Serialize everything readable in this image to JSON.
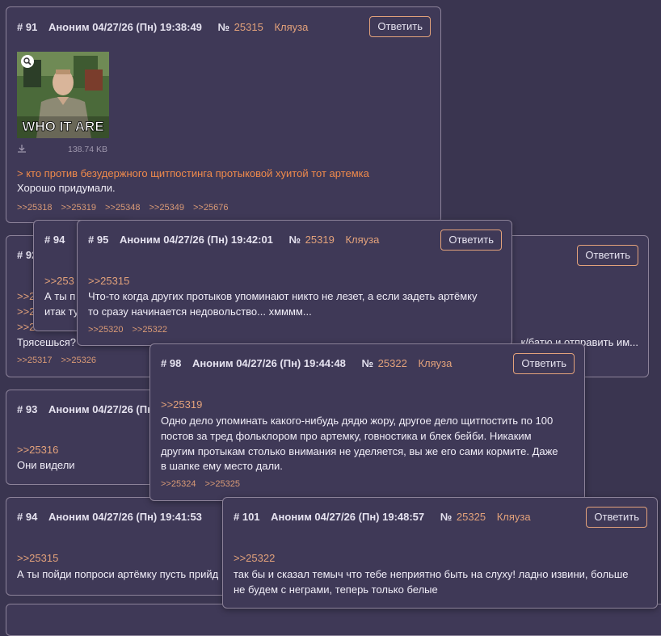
{
  "reply_label": "Ответить",
  "no_label": "№",
  "posts": {
    "p91": {
      "num": "# 91",
      "author": "Аноним 04/27/26 (Пн) 19:38:49",
      "id": "25315",
      "tag": "Кляуза",
      "image_caption": "WHO IT ARE",
      "file_size": "138.74 KB",
      "greentext": "> кто против безудержного щитпостинга протыковой хуитой тот артемка",
      "text": "Хорошо придумали.",
      "refs": [
        ">>25318",
        ">>25319",
        ">>25348",
        ">>25349",
        ">>25676"
      ]
    },
    "p92": {
      "num": "# 92",
      "quotes": [
        ">>2",
        ">>2",
        ">>2"
      ],
      "text": "Трясешься?",
      "tail_text": "к/батю и отправить им...",
      "refs": [
        ">>25317",
        ">>25326"
      ]
    },
    "p93": {
      "num": "# 93",
      "author": "Аноним 04/27/26 (Пн",
      "quote": ">>25316",
      "text": "Они видели"
    },
    "p94": {
      "num": "# 94",
      "author": "Аноним 04/27/26 (Пн) 19:41:53",
      "quote": ">>25315",
      "text": "А ты пойди попроси артёмку пусть прийд"
    },
    "p94pop": {
      "num": "# 94",
      "quote": ">>253",
      "text1": "А ты п",
      "text2": "итак ту"
    },
    "p95": {
      "num": "# 95",
      "author": "Аноним 04/27/26 (Пн) 19:42:01",
      "id": "25319",
      "tag": "Кляуза",
      "quote": ">>25315",
      "text1": "Что-то когда других протыков упоминают никто не лезет, а если задеть артёмку",
      "text2": "то сразу начинается недовольство... хмммм...",
      "refs": [
        ">>25320",
        ">>25322"
      ]
    },
    "p98": {
      "num": "# 98",
      "author": "Аноним 04/27/26 (Пн) 19:44:48",
      "id": "25322",
      "tag": "Кляуза",
      "quote": ">>25319",
      "lines": [
        "Одно дело упоминать какого-нибудь дядю жору, другое дело щитпостить по 100",
        "постов за тред фольклором про артемку, говностика и блек бейби. Никаким",
        "другим протыкам столько внимания не уделяется, вы же его сами кормите. Даже",
        "в шапке ему место дали."
      ],
      "refs": [
        ">>25324",
        ">>25325"
      ]
    },
    "p101": {
      "num": "# 101",
      "author": "Аноним 04/27/26 (Пн) 19:48:57",
      "id": "25325",
      "tag": "Кляуза",
      "quote": ">>25322",
      "text1": "так бы и сказал темыч что тебе неприятно быть на слуху! ладно извини, больше",
      "text2": "не будем с неграми, теперь только белые"
    }
  }
}
